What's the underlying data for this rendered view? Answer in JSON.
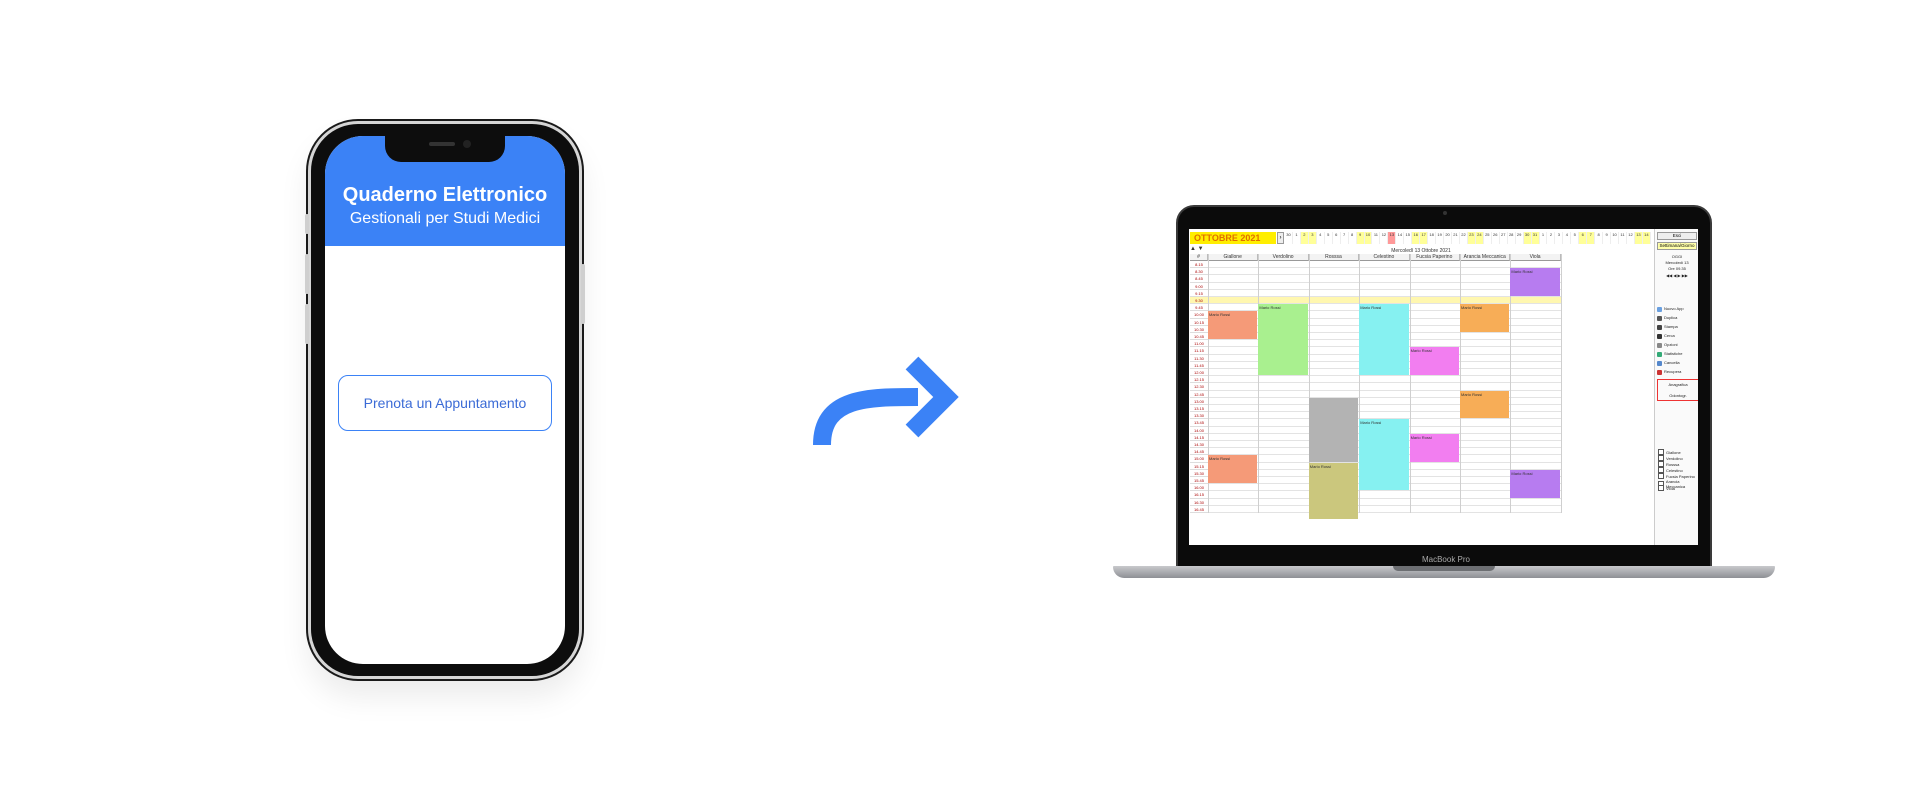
{
  "phone": {
    "title": "Quaderno Elettronico",
    "subtitle": "Gestionali per Studi Medici",
    "book_button": "Prenota un Appuntamento",
    "header_color": "#3b82f6"
  },
  "arrow": {
    "icon": "curved-arrow-right-icon",
    "color": "#3b82f6"
  },
  "laptop": {
    "brand": "MacBook Pro",
    "calendar": {
      "month": "OTTOBRE 2021",
      "date_title": "Mercoledì 13 Ottobre 2021",
      "days": [
        "30",
        "1",
        "2",
        "3",
        "4",
        "5",
        "6",
        "7",
        "8",
        "9",
        "10",
        "11",
        "12",
        "13",
        "14",
        "15",
        "16",
        "17",
        "18",
        "19",
        "20",
        "21",
        "22",
        "23",
        "24",
        "25",
        "26",
        "27",
        "28",
        "29",
        "30",
        "31",
        "1",
        "2",
        "3",
        "4",
        "5",
        "6",
        "7",
        "8",
        "9",
        "10",
        "11",
        "12",
        "13",
        "14"
      ],
      "columns": [
        "#",
        "Giallone",
        "Verdolino",
        "Rosssa",
        "Celestino",
        "Fucsia Paperino",
        "Arancia Meccanica",
        "Viola"
      ],
      "times": [
        "8.15",
        "8.30",
        "8.45",
        "9.00",
        "9.15",
        "9.30",
        "9.45",
        "10.00",
        "10.15",
        "10.30",
        "10.45",
        "11.00",
        "11.15",
        "11.30",
        "11.45",
        "12.00",
        "12.15",
        "12.30",
        "12.45",
        "13.00",
        "13.15",
        "13.30",
        "13.45",
        "14.00",
        "14.15",
        "14.30",
        "14.45",
        "15.00",
        "15.15",
        "15.30",
        "15.45",
        "16.00",
        "16.15",
        "16.30",
        "16.45"
      ],
      "appointments": [
        {
          "label": "Mario Rossi",
          "col": 7,
          "start": 1,
          "len": 4,
          "color": "#b77cf0"
        },
        {
          "label": "Mario Rossi",
          "col": 2,
          "start": 6,
          "len": 10,
          "color": "#a9f08f"
        },
        {
          "label": "Mario Rossi",
          "col": 4,
          "start": 6,
          "len": 10,
          "color": "#86f1f1"
        },
        {
          "label": "Mario Rossi",
          "col": 6,
          "start": 6,
          "len": 4,
          "color": "#f7ad57"
        },
        {
          "label": "Mario Rossi",
          "col": 1,
          "start": 7,
          "len": 4,
          "color": "#f59a78"
        },
        {
          "label": "Mario Rossi",
          "col": 5,
          "start": 12,
          "len": 4,
          "color": "#f27ef0"
        },
        {
          "label": "Mario Rossi",
          "col": 6,
          "start": 18,
          "len": 4,
          "color": "#f7ad57"
        },
        {
          "label": "",
          "col": 3,
          "start": 19,
          "len": 9,
          "color": "#b3b3b3"
        },
        {
          "label": "Mario Rossi",
          "col": 4,
          "start": 22,
          "len": 10,
          "color": "#86f1f1"
        },
        {
          "label": "Mario Rossi",
          "col": 5,
          "start": 24,
          "len": 4,
          "color": "#f27ef0"
        },
        {
          "label": "Mario Rossi",
          "col": 1,
          "start": 27,
          "len": 4,
          "color": "#f59a78"
        },
        {
          "label": "Mario Rossi",
          "col": 3,
          "start": 28,
          "len": 8,
          "color": "#cbc77d"
        },
        {
          "label": "Mario Rossi",
          "col": 7,
          "start": 29,
          "len": 4,
          "color": "#b77cf0"
        }
      ],
      "highlight_row": 5,
      "sidebar": {
        "top_button": "Esci",
        "view_button": "Settimana/Giorno",
        "today_label": "OGGI",
        "date_label": "Mercoledì 13",
        "time_label": "Ore 09.35",
        "items": [
          {
            "label": "Nuovo App",
            "icon": "calendar-icon",
            "color": "#6aa0e0"
          },
          {
            "label": "Duplica",
            "icon": "copy-icon",
            "color": "#555"
          },
          {
            "label": "Stampa",
            "icon": "printer-icon",
            "color": "#444"
          },
          {
            "label": "Cerca",
            "icon": "search-icon",
            "color": "#333"
          },
          {
            "label": "Opzioni",
            "icon": "gear-icon",
            "color": "#888"
          },
          {
            "label": "Statistiche",
            "icon": "chart-icon",
            "color": "#3a7"
          },
          {
            "label": "Cancella",
            "icon": "eraser-icon",
            "color": "#58c"
          },
          {
            "label": "Recupera",
            "icon": "trash-icon",
            "color": "#c33"
          }
        ],
        "anagrafica": "Anagrafica",
        "odontogramma": "Odontogr.",
        "legend": [
          "Giallone",
          "Verdolino",
          "Rosssa",
          "Celestino",
          "Fucsia Paperino",
          "Arancia Meccanica",
          "Viola"
        ]
      }
    }
  }
}
